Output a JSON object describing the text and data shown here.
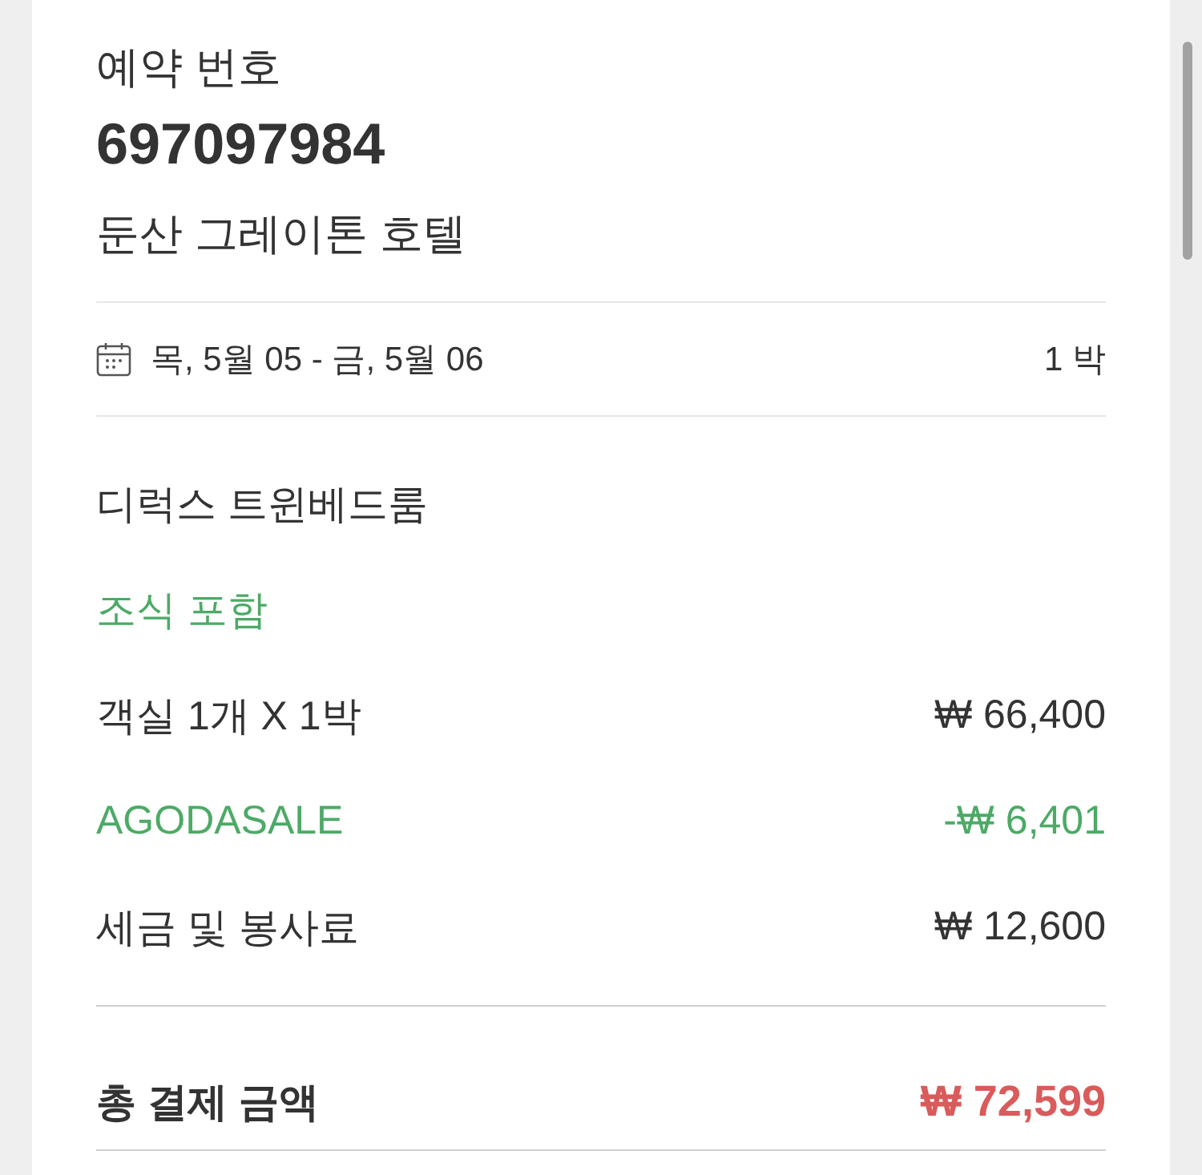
{
  "booking": {
    "label": "예약 번호",
    "number": "697097984",
    "hotel": "둔산 그레이톤 호텔"
  },
  "stay": {
    "dates": "목, 5월 05 - 금, 5월 06",
    "nights": "1 박"
  },
  "room": {
    "name": "디럭스 트윈베드룸",
    "perks": [
      {
        "text": "조식 포함",
        "kind": "benefit"
      }
    ]
  },
  "charges": [
    {
      "label": "객실 1개 X 1박",
      "amount": "₩ 66,400",
      "kind": "charge"
    },
    {
      "label": "AGODASALE",
      "amount": "-₩ 6,401",
      "kind": "discount"
    },
    {
      "label": "세금 및 봉사료",
      "amount": "₩ 12,600",
      "kind": "charge"
    }
  ],
  "total": {
    "label": "총 결제 금액",
    "amount": "₩ 72,599"
  }
}
